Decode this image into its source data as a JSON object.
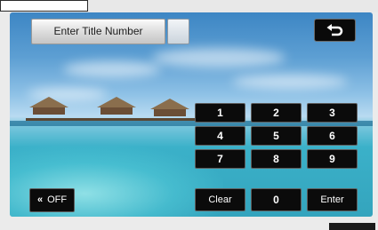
{
  "header": {
    "title_button_label": "Enter Title Number",
    "title_number_value": ""
  },
  "keypad": {
    "keys": [
      {
        "label": "1"
      },
      {
        "label": "2"
      },
      {
        "label": "3"
      },
      {
        "label": "4"
      },
      {
        "label": "5"
      },
      {
        "label": "6"
      },
      {
        "label": "7"
      },
      {
        "label": "8"
      },
      {
        "label": "9"
      },
      {
        "label": "Clear"
      },
      {
        "label": "0"
      },
      {
        "label": "Enter"
      }
    ]
  },
  "controls": {
    "off_label": "OFF",
    "off_chevron": "«"
  },
  "icons": {
    "back": "return-arrow-icon"
  },
  "colors": {
    "key_background": "#0b0b0b",
    "key_text": "#ffffff",
    "header_button": "#d9d9d9"
  }
}
